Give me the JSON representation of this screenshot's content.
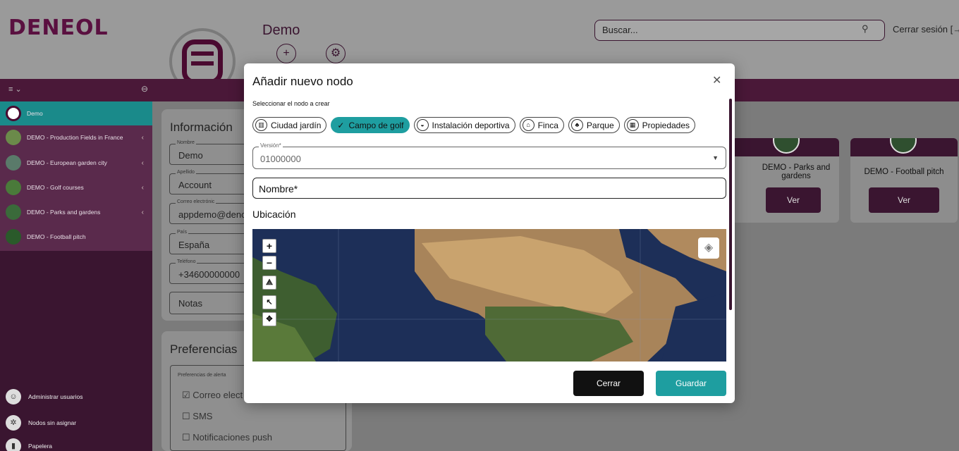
{
  "header": {
    "logo": "DENEOL",
    "search_placeholder": "Buscar...",
    "logout": "Cerrar sesión [→"
  },
  "page": {
    "title": "Demo"
  },
  "sidebar": {
    "items": [
      {
        "label": "Demo"
      },
      {
        "label": "DEMO - Production Fields in France"
      },
      {
        "label": "DEMO - European garden city"
      },
      {
        "label": "DEMO - Golf courses"
      },
      {
        "label": "DEMO - Parks and gardens"
      },
      {
        "label": "DEMO - Football pitch"
      }
    ],
    "bottom": [
      {
        "label": "Administrar usuarios",
        "icon": "users-icon"
      },
      {
        "label": "Nodos sin asignar",
        "icon": "nodes-icon"
      },
      {
        "label": "Papelera",
        "icon": "trash-icon"
      }
    ]
  },
  "info": {
    "title": "Información",
    "fields": [
      {
        "label": "Nombre",
        "value": "Demo"
      },
      {
        "label": "Apellido",
        "value": "Account"
      },
      {
        "label": "Correo electrónic",
        "value": "appdemo@denoc"
      },
      {
        "label": "País",
        "value": "España"
      },
      {
        "label": "Teléfono",
        "value": "+34600000000"
      },
      {
        "label": "",
        "value": "Notas"
      }
    ]
  },
  "prefs": {
    "title": "Preferencias",
    "group_label": "Preferencias de alerta",
    "options": [
      {
        "label": "Correo elect",
        "checked": true
      },
      {
        "label": "SMS",
        "checked": false
      },
      {
        "label": "Notificaciones push",
        "checked": false
      }
    ]
  },
  "node_cards": [
    {
      "name": "DEMO - Parks and gardens",
      "button": "Ver"
    },
    {
      "name": "DEMO - Football pitch",
      "button": "Ver"
    }
  ],
  "modal": {
    "title": "Añadir nuevo nodo",
    "subtitle": "Seleccionar el nodo a crear",
    "chips": [
      {
        "label": "Ciudad jardín",
        "selected": false,
        "icon": "city-icon"
      },
      {
        "label": "Campo de golf",
        "selected": true,
        "icon": "check-icon"
      },
      {
        "label": "Instalación deportiva",
        "selected": false,
        "icon": "stadium-icon"
      },
      {
        "label": "Finca",
        "selected": false,
        "icon": "farm-icon"
      },
      {
        "label": "Parque",
        "selected": false,
        "icon": "park-icon"
      },
      {
        "label": "Propiedades",
        "selected": false,
        "icon": "property-icon"
      }
    ],
    "version_label": "Versión*",
    "version_value": "01000000",
    "name_placeholder": "Nombre*",
    "location_label": "Ubicación",
    "map_controls": [
      "+",
      "−"
    ],
    "close_button": "Cerrar",
    "save_button": "Guardar",
    "colors": {
      "accent": "#1e9ea0",
      "primary": "#3a1530"
    }
  }
}
